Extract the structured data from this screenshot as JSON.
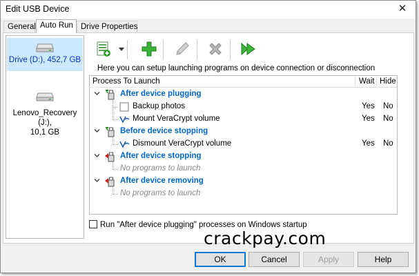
{
  "window": {
    "title": "Edit USB Device",
    "close_glyph": "✕"
  },
  "tabs": [
    {
      "label": "General",
      "active": false
    },
    {
      "label": "Auto Run",
      "active": true
    },
    {
      "label": "Drive Properties",
      "active": false
    }
  ],
  "drives": [
    {
      "label_line1": "Drive (D:), 452,7 GB",
      "label_line2": "",
      "selected": true
    },
    {
      "label_line1": "Lenovo_Recovery (J:),",
      "label_line2": "10,1 GB",
      "selected": false
    }
  ],
  "toolbar": {
    "buttons": [
      {
        "name": "add-program-menu",
        "icon": "list-add-icon",
        "enabled": true,
        "has_dropdown": true
      },
      {
        "name": "add",
        "icon": "plus-icon",
        "enabled": true
      },
      {
        "name": "edit",
        "icon": "pencil-icon",
        "enabled": false
      },
      {
        "name": "delete",
        "icon": "x-icon",
        "enabled": false
      },
      {
        "name": "run",
        "icon": "play-icon",
        "enabled": true
      }
    ]
  },
  "hint": "Here you can setup launching programs on device connection or disconnection",
  "tree": {
    "columns": {
      "process": "Process To Launch",
      "wait": "Wait",
      "hide": "Hide"
    },
    "groups": [
      {
        "label": "After device plugging",
        "icon_color": "#2e8b2e",
        "items": [
          {
            "label": "Backup photos",
            "wait": "Yes",
            "hide": "No",
            "icon": "blank-doc-icon"
          },
          {
            "label": "Mount VeraCrypt volume",
            "wait": "Yes",
            "hide": "No",
            "icon": "veracrypt-icon"
          }
        ]
      },
      {
        "label": "Before device stopping",
        "icon_color": "#2e8b2e",
        "items": [
          {
            "label": "Dismount VeraCrypt volume",
            "wait": "Yes",
            "hide": "No",
            "icon": "veracrypt-icon"
          }
        ]
      },
      {
        "label": "After device stopping",
        "icon_color": "#cc2020",
        "items": [],
        "empty_text": "No programs to launch"
      },
      {
        "label": "After device removing",
        "icon_color": "#cc2020",
        "items": [],
        "empty_text": "No programs to launch"
      }
    ]
  },
  "watermark": "crackpay.com",
  "startup_option": {
    "label": "Run \"After device plugging\" processes on Windows startup",
    "checked": false
  },
  "buttons": {
    "ok": "OK",
    "cancel": "Cancel",
    "apply": "Apply",
    "help": "Help"
  },
  "colors": {
    "group_text": "#0066cc",
    "selection": "#cce8ff",
    "default_button_border": "#0078d7"
  }
}
